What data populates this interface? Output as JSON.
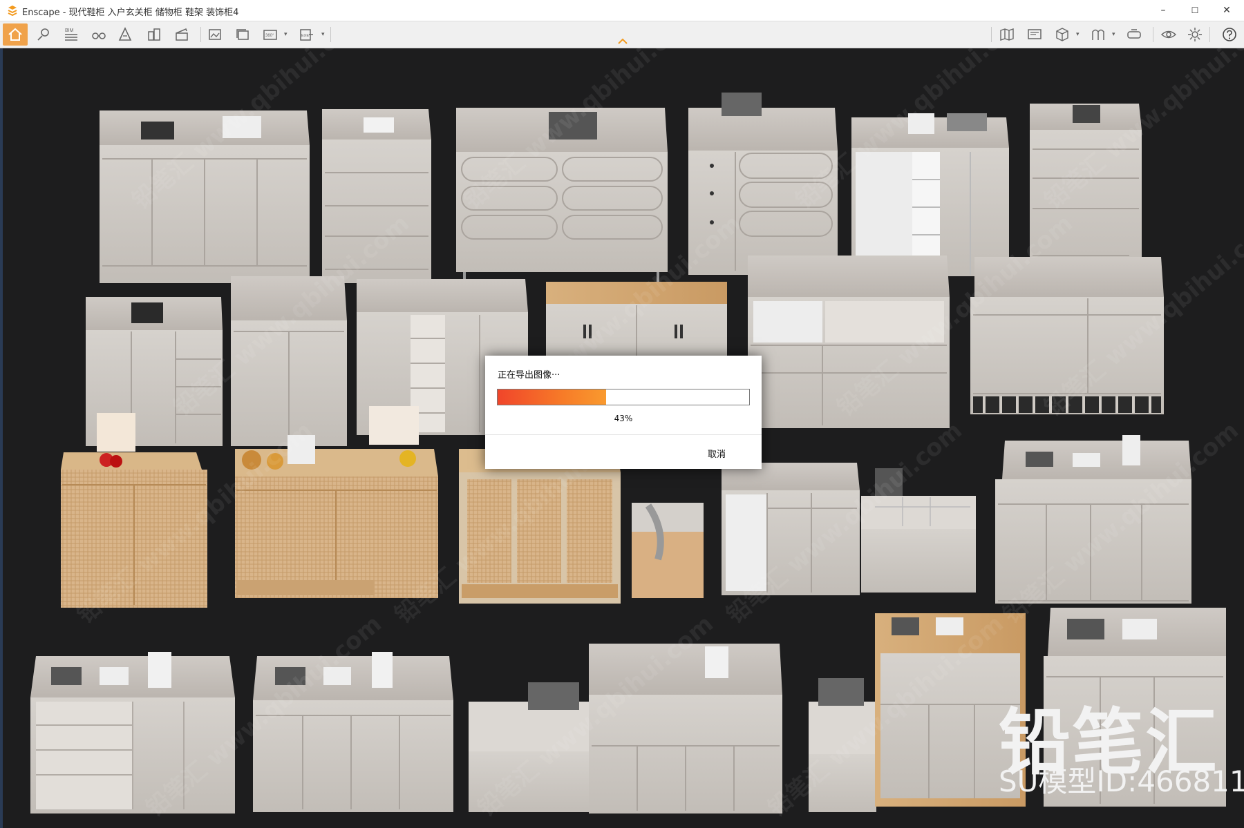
{
  "window": {
    "title": "Enscape - 现代鞋柜 入户玄关柜 储物柜 鞋架 装饰柜4",
    "minimize": "–",
    "maximize": "☐",
    "close": "✕"
  },
  "toolbar": {
    "bim_label": "BIM",
    "view360_label": "360°",
    "exe_label": "EXE",
    "accent": "#f0a24a"
  },
  "dialog": {
    "title": "正在导出图像···",
    "progress": 43,
    "progress_label": "43%",
    "cancel_label": "取消"
  },
  "watermark": {
    "brand": "铅笔汇",
    "model_id": "SU模型ID:466811",
    "repeat_text": "铅笔汇 www.qbihui.com"
  }
}
